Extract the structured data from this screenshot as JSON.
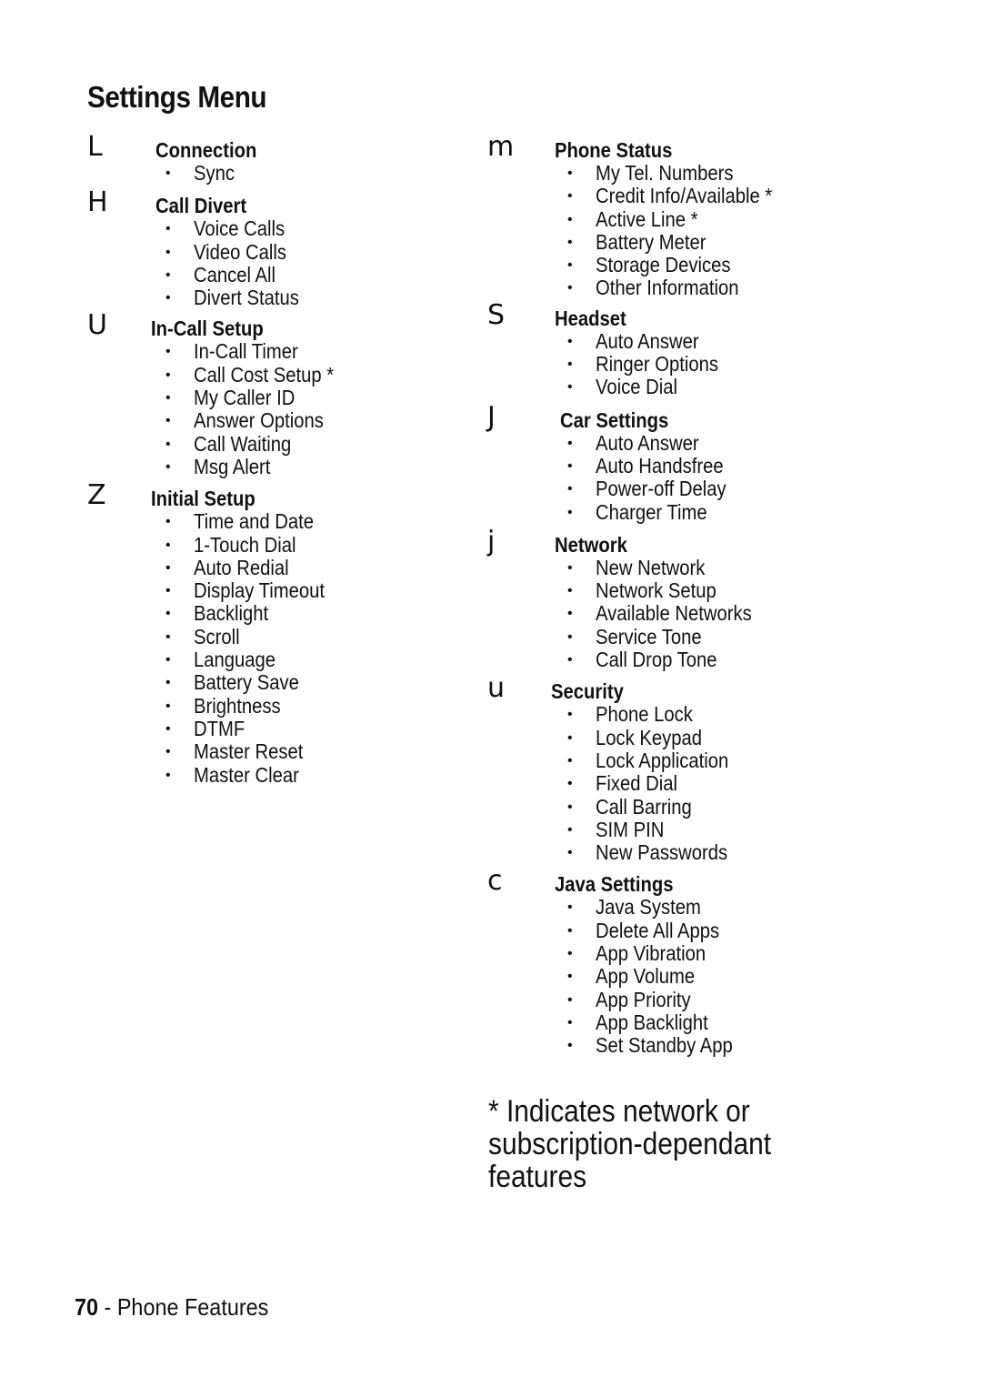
{
  "page": {
    "title": "Settings Menu",
    "footnote": "* Indicates network or subscription-dependant features",
    "footer": {
      "page_number": "70",
      "separator": " - ",
      "section": "Phone Features"
    }
  },
  "left_column": [
    {
      "icon_glyph": "L",
      "icon_name": "connection-icon",
      "title": "Connection",
      "items": [
        "Sync"
      ]
    },
    {
      "icon_glyph": "H",
      "icon_name": "call-divert-icon",
      "title": "Call Divert",
      "items": [
        "Voice Calls",
        "Video Calls",
        "Cancel All",
        "Divert Status"
      ]
    },
    {
      "icon_glyph": "U",
      "icon_name": "in-call-setup-icon",
      "title": "In-Call Setup",
      "items": [
        "In-Call Timer",
        "Call Cost Setup *",
        "My Caller ID",
        "Answer Options",
        "Call Waiting",
        "Msg Alert"
      ]
    },
    {
      "icon_glyph": "Z",
      "icon_name": "initial-setup-icon",
      "title": "Initial Setup",
      "items": [
        "Time and Date",
        "1-Touch Dial",
        "Auto Redial",
        "Display Timeout",
        "Backlight",
        "Scroll",
        "Language",
        "Battery Save",
        "Brightness",
        "DTMF",
        "Master Reset",
        "Master Clear"
      ]
    }
  ],
  "right_column": [
    {
      "icon_glyph": "m",
      "icon_name": "phone-status-icon",
      "title": "Phone Status",
      "items": [
        "My Tel. Numbers",
        "Credit Info/Available *",
        "Active Line *",
        "Battery Meter",
        "Storage Devices",
        "Other Information"
      ]
    },
    {
      "icon_glyph": "S",
      "icon_name": "headset-icon",
      "title": "Headset",
      "items": [
        "Auto Answer",
        "Ringer Options",
        "Voice Dial"
      ]
    },
    {
      "icon_glyph": "J",
      "icon_name": "car-settings-icon",
      "title": "Car Settings",
      "items": [
        "Auto Answer",
        "Auto Handsfree",
        "Power-off Delay",
        "Charger Time"
      ]
    },
    {
      "icon_glyph": "j",
      "icon_name": "network-icon",
      "title": "Network",
      "items": [
        "New Network",
        "Network Setup",
        "Available Networks",
        "Service Tone",
        "Call Drop Tone"
      ]
    },
    {
      "icon_glyph": "u",
      "icon_name": "security-icon",
      "title": "Security",
      "items": [
        "Phone Lock",
        "Lock Keypad",
        "Lock Application",
        "Fixed Dial",
        "Call Barring",
        "SIM PIN",
        "New Passwords"
      ]
    },
    {
      "icon_glyph": "c",
      "icon_name": "java-settings-icon",
      "title": "Java Settings",
      "items": [
        "Java System",
        "Delete All Apps",
        "App Vibration",
        "App Volume",
        "App Priority",
        "App Backlight",
        "Set Standby App"
      ]
    }
  ]
}
